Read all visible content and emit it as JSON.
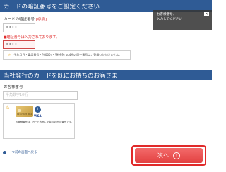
{
  "section1": {
    "title": "カードの暗証番号をご設定ください",
    "pin_label": "カードの暗証番号",
    "required": "[必須]",
    "pin_value": "••••",
    "error_text": "■暗証番号は入力されております。",
    "pin_confirm_value": "••••",
    "note_icon": "warning-icon",
    "note_text": "生年月日・電話番号・「0000」・「9999」の4桁の同一番号はご登録いただけません。"
  },
  "tooltip": {
    "line1": "お客様番号：",
    "line2": "入力してください"
  },
  "section2": {
    "title": "当社発行のカードを既にお持ちのお客さま",
    "number_label": "お客様番号",
    "number_placeholder": "半角数字10桁",
    "card_text": "お客様番号は、カード表面に記載の10桁の番号です。",
    "card_number_sample": "1234 5678 9012",
    "card_brand": "VISA"
  },
  "footer": {
    "back_label": "一つ前の画面へ戻る",
    "next_label": "次へ",
    "next_icon": "arrow-right-circle-icon"
  },
  "colors": {
    "header_blue": "#2f5b95",
    "error_red": "#e02a2a",
    "button_red": "#e34242"
  }
}
